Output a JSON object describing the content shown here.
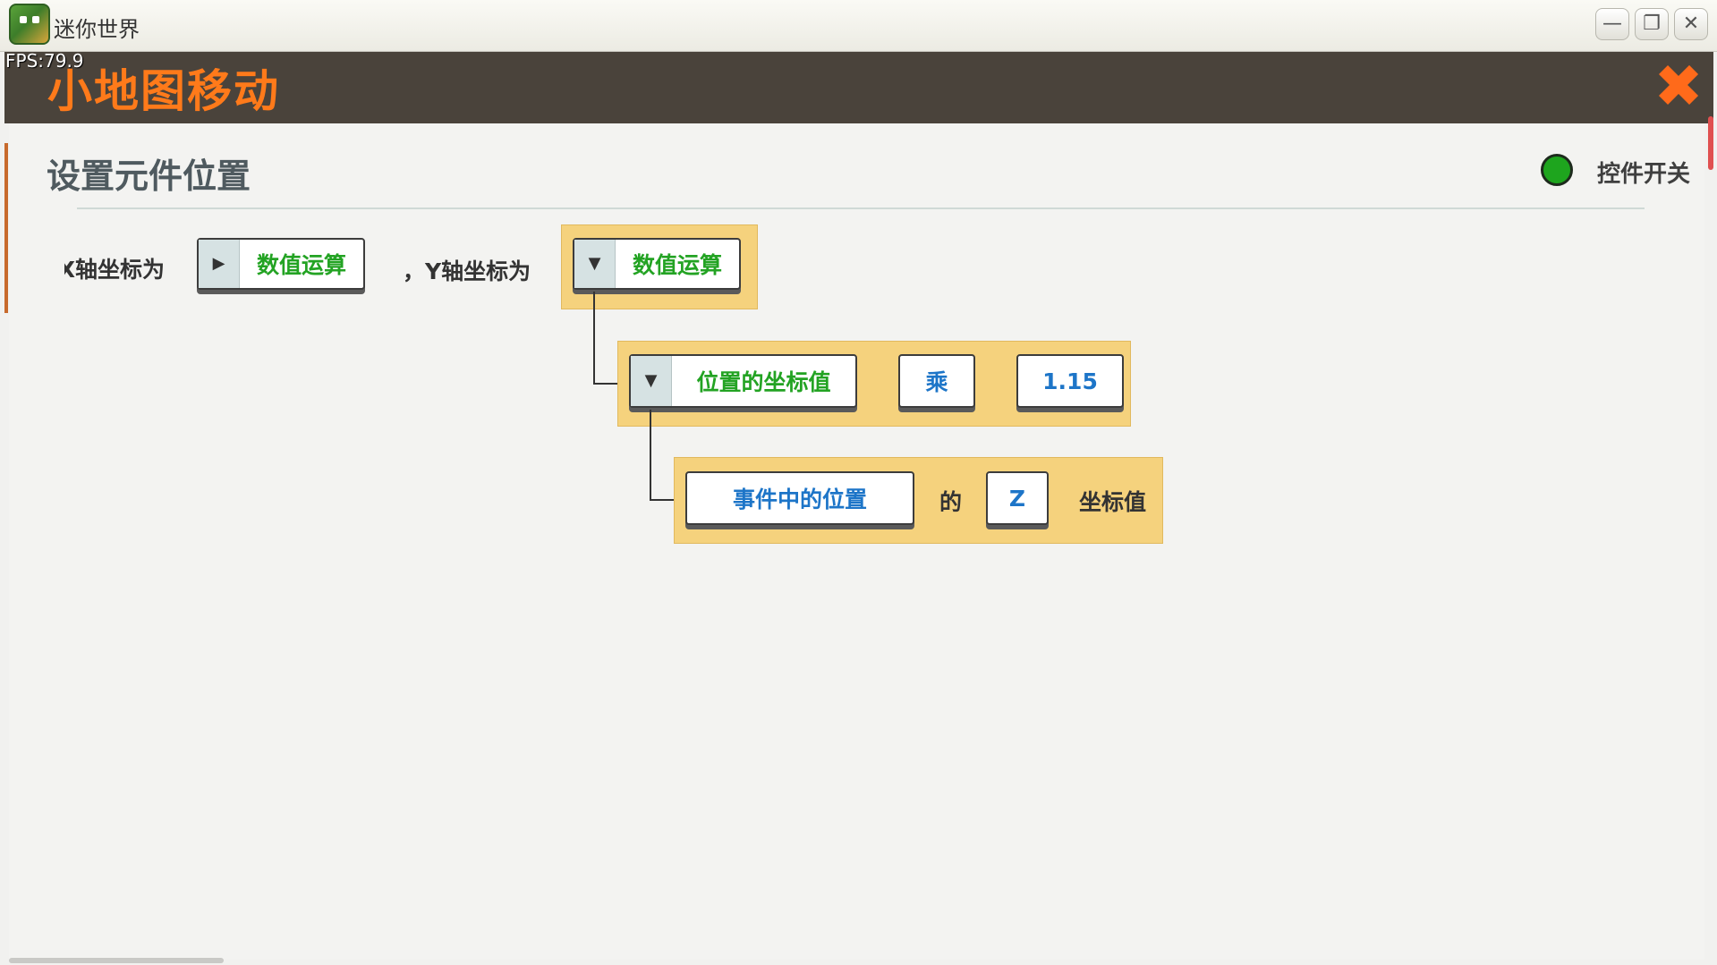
{
  "window": {
    "title": "迷你世界",
    "minimize": "—",
    "restore": "❐",
    "close": "✕"
  },
  "fps": "FPS:79.9",
  "header": {
    "title": "小地图移动",
    "close_glyph": "✖"
  },
  "section": {
    "title": "设置元件位置",
    "toggle_label": "控件开关",
    "toggle_color": "#1ea51e"
  },
  "row1": {
    "x_label": "X轴坐标为",
    "x_button": "数值运算",
    "x_arrow": "▶",
    "y_label": "，Y轴坐标为",
    "y_button": "数值运算",
    "y_arrow": "▼"
  },
  "row2": {
    "arrow": "▼",
    "position_value": "位置的坐标值",
    "operator": "乘",
    "factor": "1.15"
  },
  "row3": {
    "event_position": "事件中的位置",
    "of": "的",
    "axis": "Z",
    "coord_value": "坐标值"
  },
  "colors": {
    "header_bg": "#4a433b",
    "title_orange": "#ff7a1a",
    "block_yellow": "#f5d27d",
    "text_green": "#23a323",
    "text_blue": "#1d75c8"
  }
}
